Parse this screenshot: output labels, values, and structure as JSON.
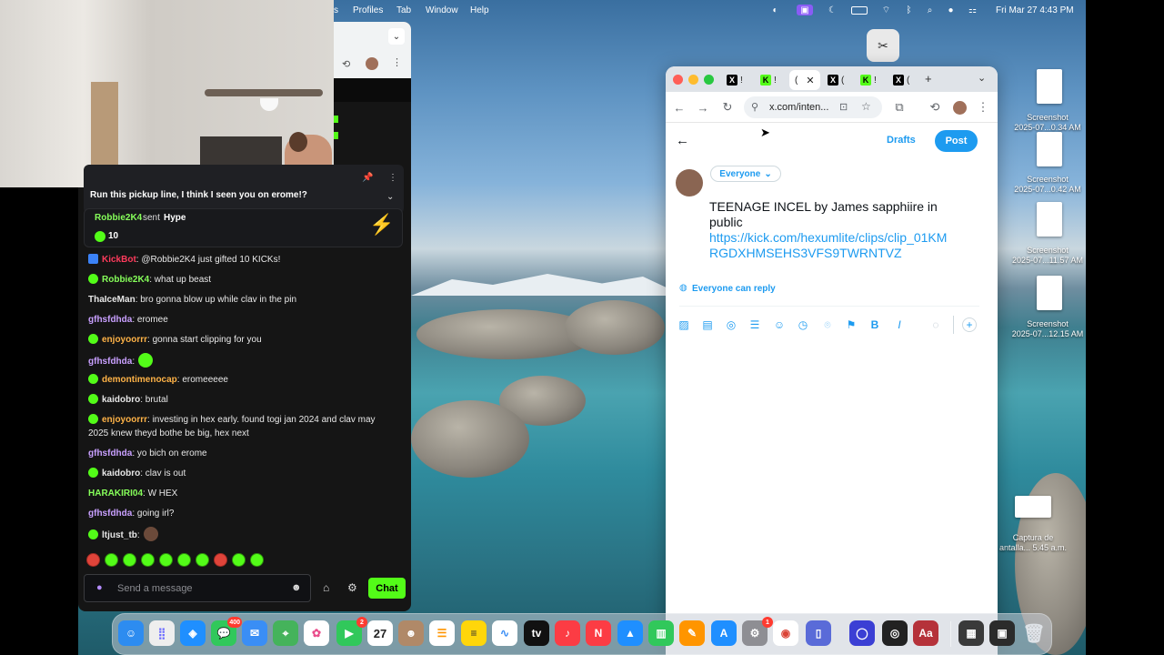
{
  "menubar": {
    "items": [
      "s",
      "Profiles",
      "Tab",
      "Window",
      "Help"
    ],
    "datetime": "Fri Mar 27  4:43 PM"
  },
  "stream_chat": {
    "pinned_message": "Run this pickup line, I think I seen you on erome!?",
    "hype": {
      "user": "Robbie2K4",
      "text": "sent",
      "item": "Hype",
      "amount": "10"
    },
    "messages": [
      {
        "user": "KickBot",
        "text": ": @Robbie2K4 just gifted 10 KICKs!",
        "color": "#ff3b5c"
      },
      {
        "user": "Robbie2K4",
        "text": ": what up beast",
        "color": "#86ff5a"
      },
      {
        "user": "ThaIceMan",
        "text": ": bro gonna blow up while clav in the pin",
        "color": "#e6e6e6"
      },
      {
        "user": "gfhsfdhda",
        "text": ": eromee",
        "color": "#c9a0ff"
      },
      {
        "user": "enjoyoorrr",
        "text": ": gonna start clipping for you",
        "color": "#ffb347"
      },
      {
        "user": "gfhsfdhda",
        "text": ":",
        "color": "#c9a0ff"
      },
      {
        "user": "demontimenocap",
        "text": ": eromeeeee",
        "color": "#ffb347"
      },
      {
        "user": "kaidobro",
        "text": ": brutal",
        "color": "#e6e6e6"
      },
      {
        "user": "enjoyoorrr",
        "text": ": investing in hex early. found togi jan 2024 and clav may 2025 knew theyd bothe be big, hex next",
        "color": "#ffb347"
      },
      {
        "user": "gfhsfdhda",
        "text": ": yo bich on erome",
        "color": "#c9a0ff"
      },
      {
        "user": "kaidobro",
        "text": ": clav is out",
        "color": "#e6e6e6"
      },
      {
        "user": "HARAKIRI04",
        "text": ": W HEX",
        "color": "#86ff5a"
      },
      {
        "user": "gfhsfdhda",
        "text": ": going irl?",
        "color": "#c9a0ff"
      },
      {
        "user": "ltjust_tb",
        "text": ":",
        "color": "#e6e6e6"
      }
    ],
    "input_placeholder": "Send a message",
    "chat_button": "Chat"
  },
  "browser": {
    "url": "x.com/inten...",
    "tabs": [
      "!",
      "!",
      "(",
      "(",
      "!",
      "("
    ]
  },
  "composer": {
    "drafts": "Drafts",
    "post": "Post",
    "audience": "Everyone",
    "text_line1": "TEENAGE INCEL by James sapphiire in",
    "text_line2": "public",
    "link_line1": "https://kick.com/hexumlite/clips/clip_01KM",
    "link_line2": "RGDXHMSEHS3VFS9TWRNTVZ",
    "reply_setting": "Everyone can reply"
  },
  "desktop_files": [
    {
      "name": "Screenshot",
      "date": "2025-07...0.34 AM"
    },
    {
      "name": "Screenshot",
      "date": "2025-07...0.42 AM"
    },
    {
      "name": "Screenshot",
      "date": "2025-07...11.57 AM"
    },
    {
      "name": "Screenshot",
      "date": "2025-07...12.15 AM"
    },
    {
      "name": "Captura de",
      "date": "antalla... 5.45 a.m."
    }
  ],
  "dock": {
    "messages_badge": "400",
    "facetime_badge": "2",
    "calendar_day": "27",
    "settings_badge": "1"
  }
}
